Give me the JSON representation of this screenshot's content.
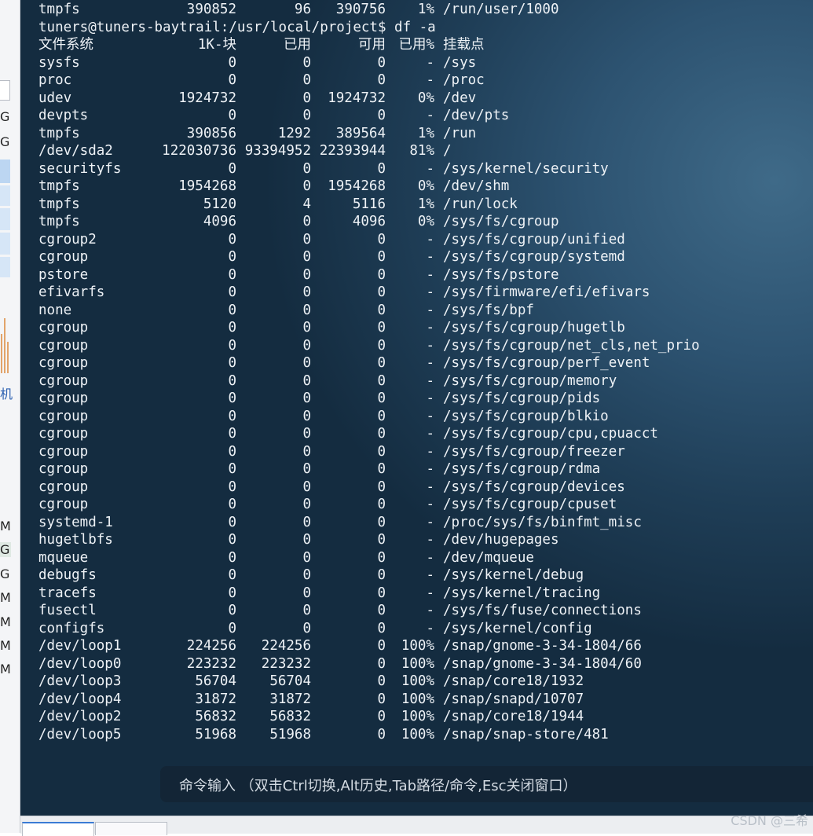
{
  "terminal": {
    "lines": [
      {
        "fs": "tmpfs",
        "size": "390852",
        "used": "96",
        "avail": "390756",
        "pct": "1%",
        "mount": "/run/user/1000"
      },
      {
        "prompt": "tuners@tuners-baytrail:/usr/local/project$ df -a"
      },
      {
        "fs": "文件系统",
        "size": "1K-块",
        "used": "已用",
        "avail": "可用",
        "pct": "已用%",
        "mount": "挂载点"
      },
      {
        "fs": "sysfs",
        "size": "0",
        "used": "0",
        "avail": "0",
        "pct": "-",
        "mount": "/sys"
      },
      {
        "fs": "proc",
        "size": "0",
        "used": "0",
        "avail": "0",
        "pct": "-",
        "mount": "/proc"
      },
      {
        "fs": "udev",
        "size": "1924732",
        "used": "0",
        "avail": "1924732",
        "pct": "0%",
        "mount": "/dev"
      },
      {
        "fs": "devpts",
        "size": "0",
        "used": "0",
        "avail": "0",
        "pct": "-",
        "mount": "/dev/pts"
      },
      {
        "fs": "tmpfs",
        "size": "390856",
        "used": "1292",
        "avail": "389564",
        "pct": "1%",
        "mount": "/run"
      },
      {
        "fs": "/dev/sda2",
        "size": "122030736",
        "used": "93394952",
        "avail": "22393944",
        "pct": "81%",
        "mount": "/"
      },
      {
        "fs": "securityfs",
        "size": "0",
        "used": "0",
        "avail": "0",
        "pct": "-",
        "mount": "/sys/kernel/security"
      },
      {
        "fs": "tmpfs",
        "size": "1954268",
        "used": "0",
        "avail": "1954268",
        "pct": "0%",
        "mount": "/dev/shm"
      },
      {
        "fs": "tmpfs",
        "size": "5120",
        "used": "4",
        "avail": "5116",
        "pct": "1%",
        "mount": "/run/lock"
      },
      {
        "fs": "tmpfs",
        "size": "4096",
        "used": "0",
        "avail": "4096",
        "pct": "0%",
        "mount": "/sys/fs/cgroup"
      },
      {
        "fs": "cgroup2",
        "size": "0",
        "used": "0",
        "avail": "0",
        "pct": "-",
        "mount": "/sys/fs/cgroup/unified"
      },
      {
        "fs": "cgroup",
        "size": "0",
        "used": "0",
        "avail": "0",
        "pct": "-",
        "mount": "/sys/fs/cgroup/systemd"
      },
      {
        "fs": "pstore",
        "size": "0",
        "used": "0",
        "avail": "0",
        "pct": "-",
        "mount": "/sys/fs/pstore"
      },
      {
        "fs": "efivarfs",
        "size": "0",
        "used": "0",
        "avail": "0",
        "pct": "-",
        "mount": "/sys/firmware/efi/efivars"
      },
      {
        "fs": "none",
        "size": "0",
        "used": "0",
        "avail": "0",
        "pct": "-",
        "mount": "/sys/fs/bpf"
      },
      {
        "fs": "cgroup",
        "size": "0",
        "used": "0",
        "avail": "0",
        "pct": "-",
        "mount": "/sys/fs/cgroup/hugetlb"
      },
      {
        "fs": "cgroup",
        "size": "0",
        "used": "0",
        "avail": "0",
        "pct": "-",
        "mount": "/sys/fs/cgroup/net_cls,net_prio"
      },
      {
        "fs": "cgroup",
        "size": "0",
        "used": "0",
        "avail": "0",
        "pct": "-",
        "mount": "/sys/fs/cgroup/perf_event"
      },
      {
        "fs": "cgroup",
        "size": "0",
        "used": "0",
        "avail": "0",
        "pct": "-",
        "mount": "/sys/fs/cgroup/memory"
      },
      {
        "fs": "cgroup",
        "size": "0",
        "used": "0",
        "avail": "0",
        "pct": "-",
        "mount": "/sys/fs/cgroup/pids"
      },
      {
        "fs": "cgroup",
        "size": "0",
        "used": "0",
        "avail": "0",
        "pct": "-",
        "mount": "/sys/fs/cgroup/blkio"
      },
      {
        "fs": "cgroup",
        "size": "0",
        "used": "0",
        "avail": "0",
        "pct": "-",
        "mount": "/sys/fs/cgroup/cpu,cpuacct"
      },
      {
        "fs": "cgroup",
        "size": "0",
        "used": "0",
        "avail": "0",
        "pct": "-",
        "mount": "/sys/fs/cgroup/freezer"
      },
      {
        "fs": "cgroup",
        "size": "0",
        "used": "0",
        "avail": "0",
        "pct": "-",
        "mount": "/sys/fs/cgroup/rdma"
      },
      {
        "fs": "cgroup",
        "size": "0",
        "used": "0",
        "avail": "0",
        "pct": "-",
        "mount": "/sys/fs/cgroup/devices"
      },
      {
        "fs": "cgroup",
        "size": "0",
        "used": "0",
        "avail": "0",
        "pct": "-",
        "mount": "/sys/fs/cgroup/cpuset"
      },
      {
        "fs": "systemd-1",
        "size": "0",
        "used": "0",
        "avail": "0",
        "pct": "-",
        "mount": "/proc/sys/fs/binfmt_misc"
      },
      {
        "fs": "hugetlbfs",
        "size": "0",
        "used": "0",
        "avail": "0",
        "pct": "-",
        "mount": "/dev/hugepages"
      },
      {
        "fs": "mqueue",
        "size": "0",
        "used": "0",
        "avail": "0",
        "pct": "-",
        "mount": "/dev/mqueue"
      },
      {
        "fs": "debugfs",
        "size": "0",
        "used": "0",
        "avail": "0",
        "pct": "-",
        "mount": "/sys/kernel/debug"
      },
      {
        "fs": "tracefs",
        "size": "0",
        "used": "0",
        "avail": "0",
        "pct": "-",
        "mount": "/sys/kernel/tracing"
      },
      {
        "fs": "fusectl",
        "size": "0",
        "used": "0",
        "avail": "0",
        "pct": "-",
        "mount": "/sys/fs/fuse/connections"
      },
      {
        "fs": "configfs",
        "size": "0",
        "used": "0",
        "avail": "0",
        "pct": "-",
        "mount": "/sys/kernel/config"
      },
      {
        "fs": "/dev/loop1",
        "size": "224256",
        "used": "224256",
        "avail": "0",
        "pct": "100%",
        "mount": "/snap/gnome-3-34-1804/66"
      },
      {
        "fs": "/dev/loop0",
        "size": "223232",
        "used": "223232",
        "avail": "0",
        "pct": "100%",
        "mount": "/snap/gnome-3-34-1804/60"
      },
      {
        "fs": "/dev/loop3",
        "size": "56704",
        "used": "56704",
        "avail": "0",
        "pct": "100%",
        "mount": "/snap/core18/1932"
      },
      {
        "fs": "/dev/loop4",
        "size": "31872",
        "used": "31872",
        "avail": "0",
        "pct": "100%",
        "mount": "/snap/snapd/10707"
      },
      {
        "fs": "/dev/loop2",
        "size": "56832",
        "used": "56832",
        "avail": "0",
        "pct": "100%",
        "mount": "/snap/core18/1944"
      },
      {
        "fs": "/dev/loop5",
        "size": "51968",
        "used": "51968",
        "avail": "0",
        "pct": "100%",
        "mount": "/snap/snap-store/481"
      }
    ]
  },
  "command_bar": {
    "placeholder": "命令输入 （双击Ctrl切换,Alt历史,Tab路径/命令,Esc关闭窗口）"
  },
  "left_panel": {
    "chars": [
      "G",
      "G",
      "机",
      "M",
      "G",
      "G",
      "M",
      "M",
      "M",
      "M"
    ]
  },
  "watermark": "CSDN @三希",
  "icons": {
    "bottom_tabs": "tab-icon"
  },
  "colors": {
    "terminal_text": "#eef2f6",
    "terminal_bg": "#1f3e57",
    "accent": "#3a7bd5"
  }
}
